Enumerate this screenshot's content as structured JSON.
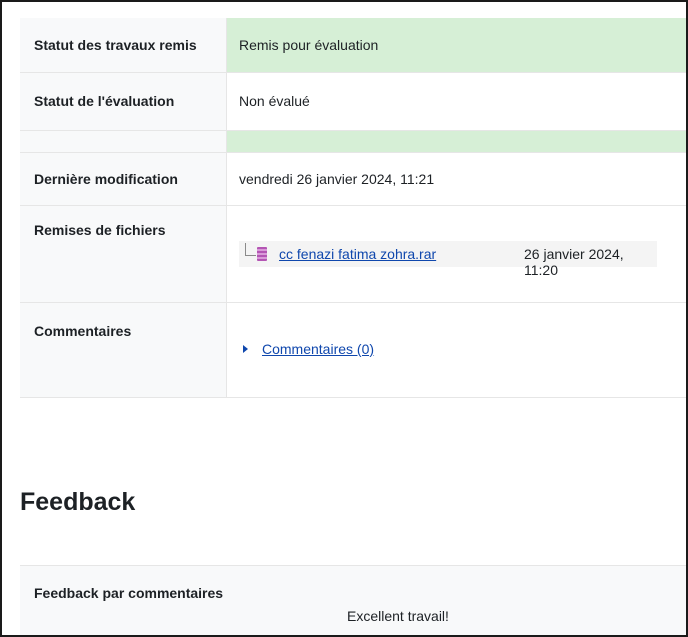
{
  "submission": {
    "status_label": "Statut des travaux remis",
    "status_value": "Remis pour évaluation",
    "grading_label": "Statut de l'évaluation",
    "grading_value": "Non évalué",
    "modified_label": "Dernière modification",
    "modified_value": "vendredi 26 janvier 2024, 11:21",
    "files_label": "Remises de fichiers",
    "file_name": "cc fenazi fatima zohra.rar",
    "file_date": "26 janvier 2024, 11:20",
    "comments_label": "Commentaires",
    "comments_link": "Commentaires (0)",
    "colors": {
      "highlight": "#d6efd6",
      "link": "#0f47ad"
    }
  },
  "feedback": {
    "title": "Feedback",
    "comments_label": "Feedback par commentaires",
    "comments_value": "Excellent travail!"
  },
  "icons": {
    "file": "archive-file-icon",
    "expand": "caret-right-icon"
  }
}
